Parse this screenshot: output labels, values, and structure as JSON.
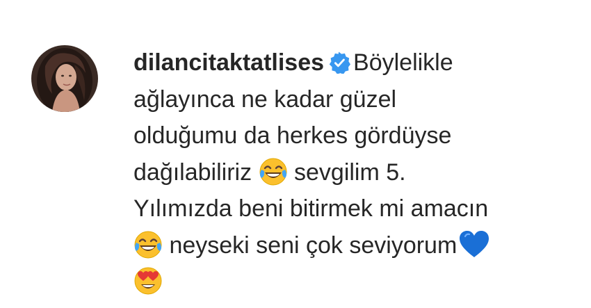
{
  "comment": {
    "username": "dilancitaktatlises",
    "verified": true,
    "lines": [
      "Böylelikle",
      "ağlayınca ne kadar güzel",
      "olduğumu da herkes gördüyse",
      "dağılabiliriz",
      "sevgilim 5.",
      "Yılımızda beni bitirmek mi amacın",
      "neyseki seni çok seviyorum"
    ],
    "icons": {
      "avatar": "profile-photo",
      "badge": "verified-badge-icon",
      "emoji_1": "face-with-tears-of-joy",
      "emoji_2": "face-with-tears-of-joy",
      "emoji_3": "blue-heart",
      "emoji_4": "smiling-face-with-heart-eyes"
    },
    "colors": {
      "text": "#262626",
      "verified": "#3897f0",
      "heart": "#1a6fd6"
    }
  }
}
